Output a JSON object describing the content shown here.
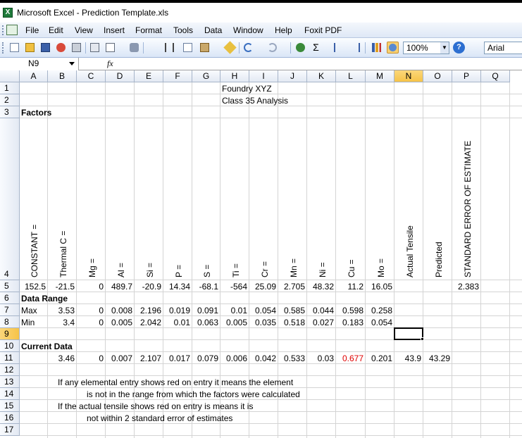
{
  "app": {
    "title": "Microsoft Excel - Prediction Template.xls",
    "icon": "excel-icon"
  },
  "menu": [
    "File",
    "Edit",
    "View",
    "Insert",
    "Format",
    "Tools",
    "Data",
    "Window",
    "Help",
    "Foxit PDF"
  ],
  "toolbar": {
    "zoom": "100%",
    "font": "Arial"
  },
  "formula_bar": {
    "name_box": "N9",
    "fx": "fx",
    "content": ""
  },
  "columns": [
    "A",
    "B",
    "C",
    "D",
    "E",
    "F",
    "G",
    "H",
    "I",
    "J",
    "K",
    "L",
    "M",
    "N",
    "O",
    "P",
    "Q"
  ],
  "rows": [
    "1",
    "2",
    "3",
    "4",
    "5",
    "6",
    "7",
    "8",
    "9",
    "10",
    "11",
    "12",
    "13",
    "14",
    "15",
    "16",
    "17"
  ],
  "selected": {
    "column": "N",
    "row": "9"
  },
  "sheet": {
    "title1": "Foundry XYZ",
    "title2": "Class 35 Analysis",
    "factors_label": "Factors",
    "headers": [
      "CONSTANT =",
      "Thermal C =",
      "Mg =",
      "Al =",
      "Si =",
      "P =",
      "S =",
      "Ti =",
      "Cr =",
      "Mn =",
      "Ni =",
      "Cu =",
      "Mo =",
      "Actual Tensile",
      "Predicted",
      "STANDARD ERROR OF ESTIMATE"
    ],
    "row5": [
      "152.5",
      "-21.5",
      "0",
      "489.7",
      "-20.9",
      "14.34",
      "-68.1",
      "-564",
      "25.09",
      "2.705",
      "48.32",
      "11.2",
      "16.05",
      "",
      "",
      "2.383"
    ],
    "data_range_label": "Data Range",
    "max_label": "Max",
    "max": [
      "3.53",
      "0",
      "0.008",
      "2.196",
      "0.019",
      "0.091",
      "0.01",
      "0.054",
      "0.585",
      "0.044",
      "0.598",
      "0.258"
    ],
    "min_label": "Min",
    "min": [
      "3.4",
      "0",
      "0.005",
      "2.042",
      "0.01",
      "0.063",
      "0.005",
      "0.035",
      "0.518",
      "0.027",
      "0.183",
      "0.054"
    ],
    "current_label": "Current Data",
    "current": [
      "3.46",
      "0",
      "0.007",
      "2.107",
      "0.017",
      "0.079",
      "0.006",
      "0.042",
      "0.533",
      "0.03",
      "0.677",
      "0.201",
      "43.9",
      "43.29"
    ],
    "note1": "If any elemental entry shows red on entry it means the element",
    "note2": "is not in the range from which the factors were calculated",
    "note3": "If the actual tensile shows red on entry is means it is",
    "note4": "not within 2 standard error of estimates"
  },
  "colors": {
    "red_value": "#e00000",
    "selected_header": "#f6c348"
  }
}
